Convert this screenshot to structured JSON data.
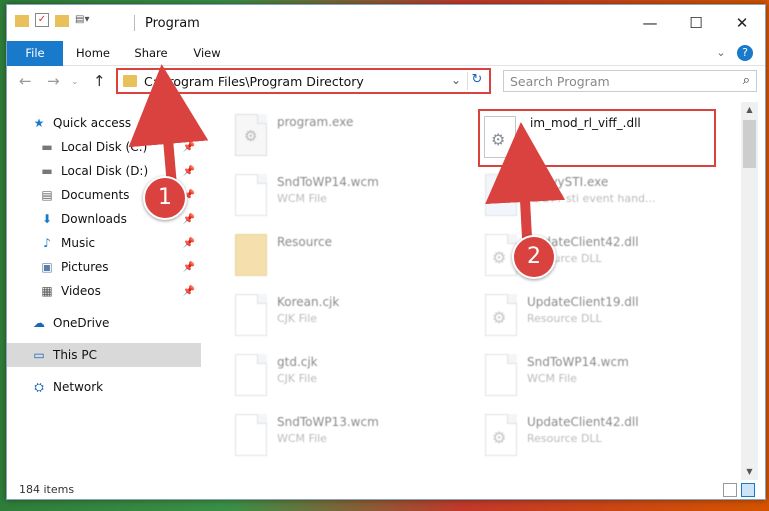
{
  "window": {
    "title": "Program"
  },
  "ribbon": {
    "tabs": [
      "File",
      "Home",
      "Share",
      "View"
    ]
  },
  "nav": {
    "back": "←",
    "forward": "→",
    "up": "↑"
  },
  "address": {
    "path": "C:\\Program Files\\Program Directory",
    "dropdown": "⌄",
    "refresh": "↻"
  },
  "search": {
    "placeholder": "Search Program",
    "icon": "⌕"
  },
  "sidebar": {
    "items": [
      {
        "label": "Quick access",
        "icon": "star-icon",
        "glyph": "★"
      },
      {
        "label": "Local Disk (C:)",
        "icon": "drive-icon",
        "glyph": "▬"
      },
      {
        "label": "Local Disk (D:)",
        "icon": "drive-icon",
        "glyph": "▬"
      },
      {
        "label": "Documents",
        "icon": "documents-icon",
        "glyph": "▤"
      },
      {
        "label": "Downloads",
        "icon": "download-icon",
        "glyph": "⬇"
      },
      {
        "label": "Music",
        "icon": "music-icon",
        "glyph": "♪"
      },
      {
        "label": "Pictures",
        "icon": "pictures-icon",
        "glyph": "▣"
      },
      {
        "label": "Videos",
        "icon": "videos-icon",
        "glyph": "▦"
      },
      {
        "label": "OneDrive",
        "icon": "cloud-icon",
        "glyph": "☁"
      },
      {
        "label": "This PC",
        "icon": "computer-icon",
        "glyph": "▭"
      },
      {
        "label": "Network",
        "icon": "network-icon",
        "glyph": "⛭"
      }
    ]
  },
  "files": [
    {
      "name": "program.exe",
      "type": ""
    },
    {
      "name": "im_mod_rl_viff_.dll",
      "type": ""
    },
    {
      "name": "SndToWP14.wcm",
      "type": "WCM File"
    },
    {
      "name": "AbbyySTI.exe",
      "type": "ABBYY sti event hand..."
    },
    {
      "name": "Resource",
      "type": ""
    },
    {
      "name": "UpdateClient42.dll",
      "type": "Resource DLL"
    },
    {
      "name": "Korean.cjk",
      "type": "CJK File"
    },
    {
      "name": "UpdateClient19.dll",
      "type": "Resource DLL"
    },
    {
      "name": "gtd.cjk",
      "type": "CJK File"
    },
    {
      "name": "SndToWP14.wcm",
      "type": "WCM File"
    },
    {
      "name": "SndToWP13.wcm",
      "type": "WCM File"
    },
    {
      "name": "UpdateClient42.dll",
      "type": "Resource DLL"
    }
  ],
  "status": {
    "count": "184 items"
  },
  "annotations": {
    "step1": "1",
    "step2": "2",
    "color": "#d9423f"
  }
}
